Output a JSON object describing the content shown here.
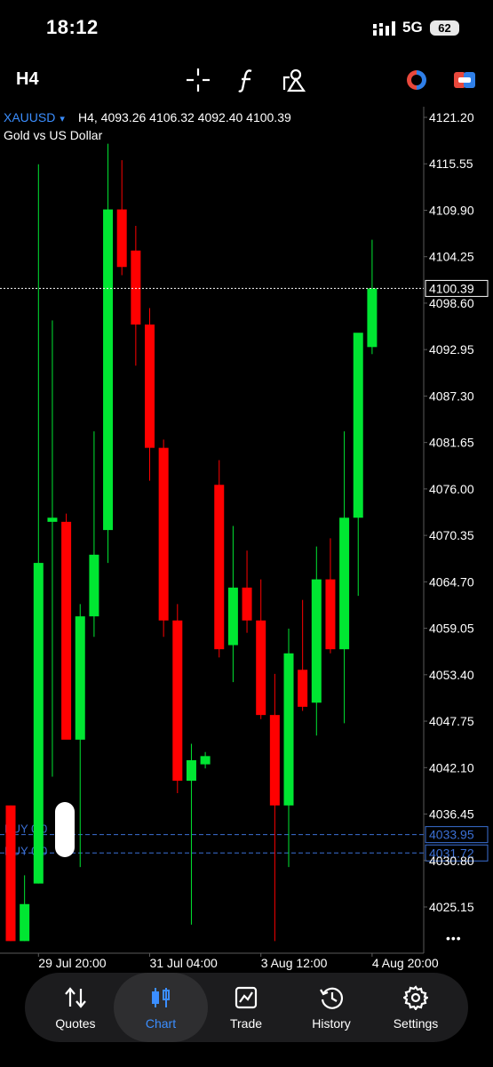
{
  "status_bar": {
    "time": "18:12",
    "network": "5G",
    "battery": "62"
  },
  "toolbar": {
    "timeframe": "H4",
    "icons": [
      "crosshair-icon",
      "indicators-icon",
      "objects-icon",
      "one-click-trading-icon",
      "trade-panel-icon"
    ]
  },
  "chart": {
    "symbol": "XAUUSD",
    "symbol_dropdown": "▾",
    "ohlc_line": "H4, 4093.26 4106.32 4092.40 4100.39",
    "description": "Gold vs US Dollar",
    "y_ticks": [
      "4121.20",
      "4115.55",
      "4109.90",
      "4104.25",
      "4098.60",
      "4092.95",
      "4087.30",
      "4081.65",
      "4076.00",
      "4070.35",
      "4064.70",
      "4059.05",
      "4053.40",
      "4047.75",
      "4042.10",
      "4036.45",
      "4030.80",
      "4025.15"
    ],
    "x_ticks": [
      "29 Jul 20:00",
      "31 Jul 04:00",
      "3 Aug 12:00",
      "4 Aug 20:00"
    ],
    "current_price": "4100.39",
    "order_lines": [
      {
        "label": "BUY 0.0",
        "price": "4033.95",
        "value": 4033.95
      },
      {
        "label": "BUY 0.0",
        "price": "4031.72",
        "value": 4031.72
      }
    ],
    "more_label": "•••",
    "colors": {
      "bull": "#00e632",
      "bear": "#ff0000",
      "order_line": "#3b6fd4",
      "bid_line": "#ffffff"
    }
  },
  "chart_data": {
    "type": "candlestick",
    "title": "XAUUSD",
    "subtitle": "Gold vs US Dollar",
    "timeframe": "H4",
    "x_tick_labels": [
      "29 Jul 20:00",
      "31 Jul 04:00",
      "3 Aug 12:00",
      "4 Aug 20:00"
    ],
    "ylim": [
      4021.0,
      4124.0
    ],
    "grid": false,
    "candles": [
      {
        "open": 4037.5,
        "high": 4037.5,
        "low": 4021.0,
        "close": 4021.0
      },
      {
        "open": 4021.0,
        "high": 4029.0,
        "low": 4021.0,
        "close": 4025.5
      },
      {
        "open": 4028.0,
        "high": 4115.5,
        "low": 4028.0,
        "close": 4067.0
      },
      {
        "open": 4072.0,
        "high": 4096.5,
        "low": 4041.0,
        "close": 4072.5
      },
      {
        "open": 4072.0,
        "high": 4073.0,
        "low": 4046.0,
        "close": 4045.5
      },
      {
        "open": 4045.5,
        "high": 4062.0,
        "low": 4030.0,
        "close": 4060.5
      },
      {
        "open": 4060.5,
        "high": 4083.0,
        "low": 4058.0,
        "close": 4068.0
      },
      {
        "open": 4071.0,
        "high": 4118.0,
        "low": 4067.0,
        "close": 4110.0
      },
      {
        "open": 4110.0,
        "high": 4116.0,
        "low": 4102.0,
        "close": 4103.0
      },
      {
        "open": 4105.0,
        "high": 4108.0,
        "low": 4091.0,
        "close": 4096.0
      },
      {
        "open": 4096.0,
        "high": 4098.0,
        "low": 4077.0,
        "close": 4081.0
      },
      {
        "open": 4081.0,
        "high": 4082.0,
        "low": 4058.0,
        "close": 4060.0
      },
      {
        "open": 4060.0,
        "high": 4062.0,
        "low": 4039.0,
        "close": 4040.5
      },
      {
        "open": 4040.5,
        "high": 4045.0,
        "low": 4023.0,
        "close": 4043.0
      },
      {
        "open": 4042.5,
        "high": 4044.0,
        "low": 4042.0,
        "close": 4043.5
      },
      {
        "open": 4076.5,
        "high": 4079.5,
        "low": 4055.5,
        "close": 4056.5
      },
      {
        "open": 4057.0,
        "high": 4071.5,
        "low": 4052.5,
        "close": 4064.0
      },
      {
        "open": 4064.0,
        "high": 4068.5,
        "low": 4058.5,
        "close": 4060.0
      },
      {
        "open": 4060.0,
        "high": 4065.0,
        "low": 4048.0,
        "close": 4048.5
      },
      {
        "open": 4048.5,
        "high": 4053.5,
        "low": 4021.0,
        "close": 4037.5
      },
      {
        "open": 4037.5,
        "high": 4059.0,
        "low": 4030.0,
        "close": 4056.0
      },
      {
        "open": 4054.0,
        "high": 4062.5,
        "low": 4049.0,
        "close": 4049.5
      },
      {
        "open": 4050.0,
        "high": 4069.0,
        "low": 4046.0,
        "close": 4065.0
      },
      {
        "open": 4065.0,
        "high": 4070.0,
        "low": 4056.0,
        "close": 4056.5
      },
      {
        "open": 4056.5,
        "high": 4083.0,
        "low": 4047.5,
        "close": 4072.5
      },
      {
        "open": 4072.5,
        "high": 4094.0,
        "low": 4063.0,
        "close": 4095.0
      },
      {
        "open": 4093.26,
        "high": 4106.32,
        "low": 4092.4,
        "close": 4100.39
      }
    ]
  },
  "bottom_nav": [
    {
      "label": "Quotes",
      "icon": "quotes-icon",
      "active": false
    },
    {
      "label": "Chart",
      "icon": "chart-icon",
      "active": true
    },
    {
      "label": "Trade",
      "icon": "trade-icon",
      "active": false
    },
    {
      "label": "History",
      "icon": "history-icon",
      "active": false
    },
    {
      "label": "Settings",
      "icon": "settings-icon",
      "active": false
    }
  ]
}
